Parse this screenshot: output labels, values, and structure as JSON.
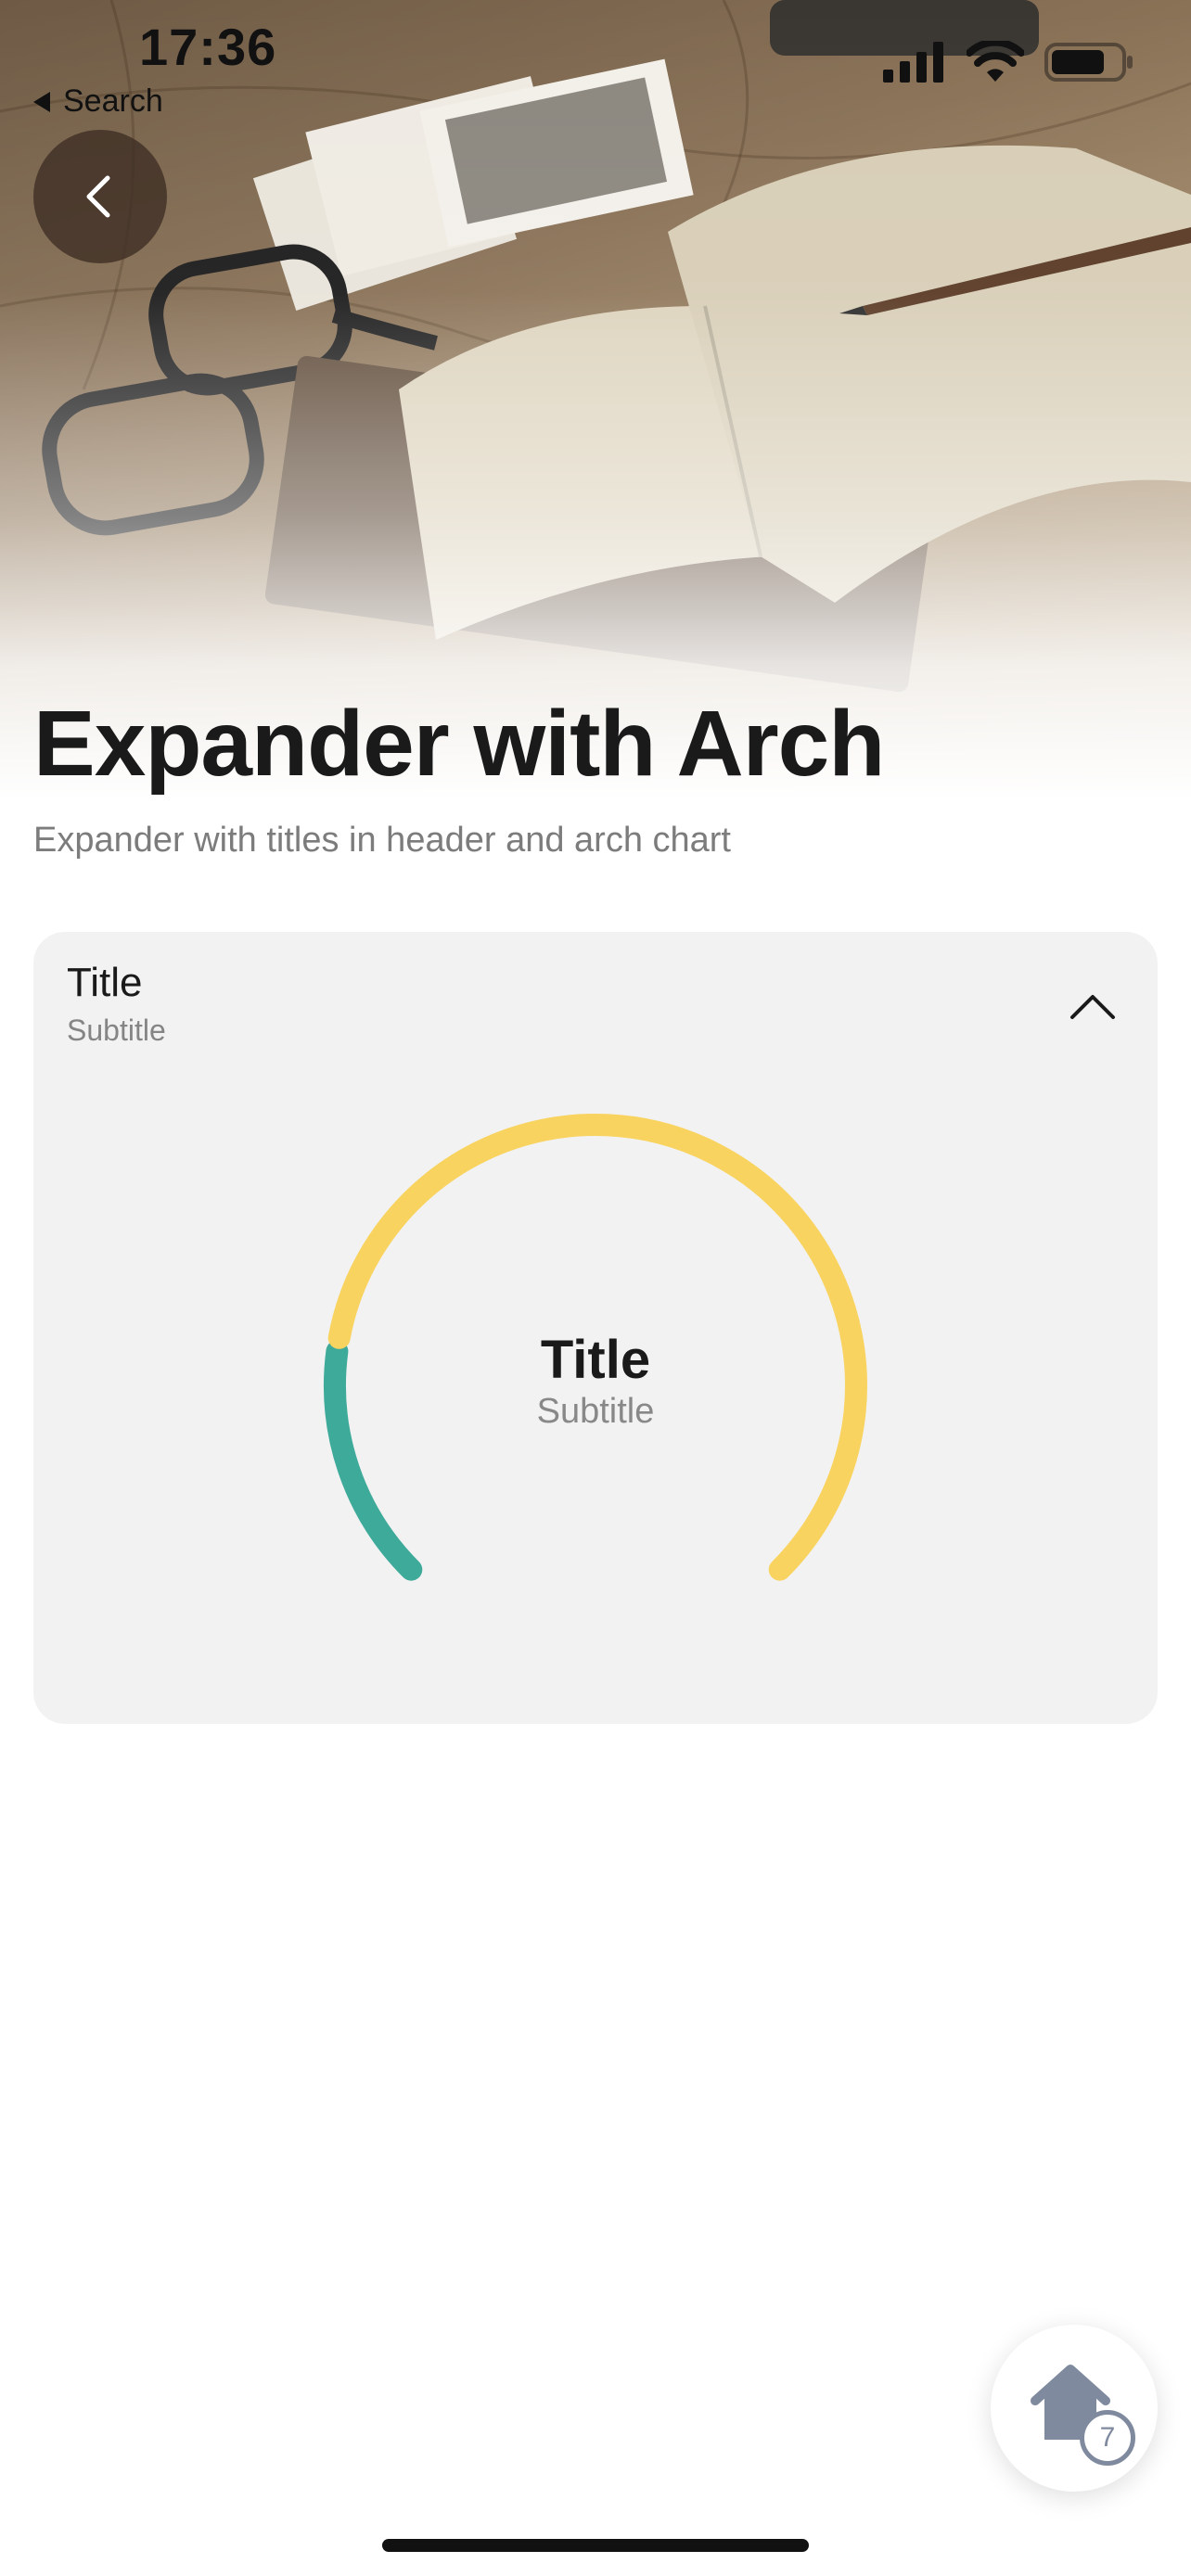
{
  "status_bar": {
    "time": "17:36",
    "back_app": "Search",
    "icons": [
      "signal-icon",
      "wifi-icon",
      "battery-icon"
    ]
  },
  "header": {
    "back_icon": "chevron-left-icon",
    "title": "Expander with Arch",
    "subtitle": "Expander with titles in header and arch chart"
  },
  "expander": {
    "title": "Title",
    "subtitle": "Subtitle",
    "expanded": true,
    "toggle_icon": "chevron-up-icon",
    "arch": {
      "title": "Title",
      "subtitle": "Subtitle",
      "segments": [
        {
          "color": "#3eaa9a",
          "fraction": 0.2
        },
        {
          "color": "#f9d35f",
          "fraction": 0.8
        }
      ]
    }
  },
  "fab": {
    "icon": "home-icon",
    "badge": "7"
  },
  "colors": {
    "accent_teal": "#3eaa9a",
    "accent_yellow": "#f9d35f",
    "card_background": "#f2f2f2",
    "text_primary": "#1a1a1a",
    "text_secondary": "#7c7c7c"
  }
}
